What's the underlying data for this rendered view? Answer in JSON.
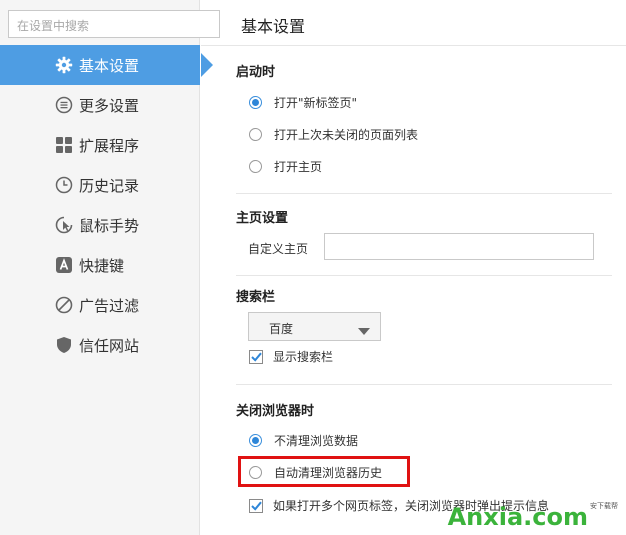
{
  "search": {
    "placeholder": "在设置中搜索"
  },
  "sidebar": {
    "items": [
      {
        "label": "基本设置",
        "icon": "gear-icon",
        "active": true
      },
      {
        "label": "更多设置",
        "icon": "list-icon"
      },
      {
        "label": "扩展程序",
        "icon": "grid-icon"
      },
      {
        "label": "历史记录",
        "icon": "clock-icon"
      },
      {
        "label": "鼠标手势",
        "icon": "gesture-icon"
      },
      {
        "label": "快捷键",
        "icon": "keyboard-a-icon"
      },
      {
        "label": "广告过滤",
        "icon": "block-icon"
      },
      {
        "label": "信任网站",
        "icon": "shield-icon"
      }
    ]
  },
  "header": {
    "title": "基本设置"
  },
  "startup": {
    "title": "启动时",
    "options": [
      {
        "label": "打开\"新标签页\"",
        "checked": true
      },
      {
        "label": "打开上次未关闭的页面列表",
        "checked": false
      },
      {
        "label": "打开主页",
        "checked": false
      }
    ]
  },
  "homepage": {
    "title": "主页设置",
    "custom_label": "自定义主页",
    "custom_value": ""
  },
  "searchbar": {
    "title": "搜索栏",
    "engine": "百度",
    "show_label": "显示搜索栏",
    "show_checked": true
  },
  "close_browser": {
    "title": "关闭浏览器时",
    "options": [
      {
        "label": "不清理浏览数据",
        "checked": true
      },
      {
        "label": "自动清理浏览器历史",
        "checked": false
      }
    ],
    "multi_tab_label": "如果打开多个网页标签，关闭浏览器时弹出提示信息",
    "multi_tab_checked": true
  },
  "watermark": {
    "text": "Anxia.com",
    "sub": "安下载帮"
  },
  "colors": {
    "accent": "#4e9de3",
    "highlight": "#e01212",
    "watermark": "#3bb33b"
  }
}
